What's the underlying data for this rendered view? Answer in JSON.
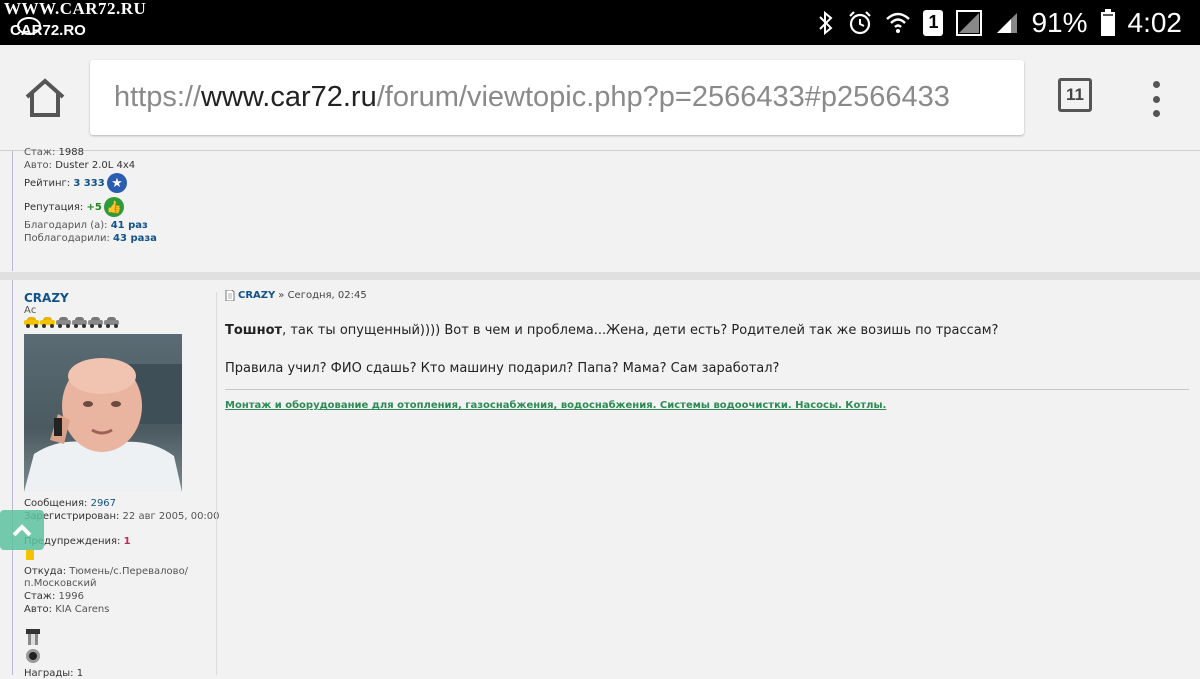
{
  "watermark": {
    "line1": "WWW.CAR72.RU",
    "line2": "CAR72.RO"
  },
  "statusbar": {
    "battery": "91%",
    "time": "4:02",
    "sim": "1",
    "icons": [
      "bluetooth-icon",
      "alarm-icon",
      "wifi-icon",
      "sim-icon",
      "no-signal-icon",
      "signal-icon",
      "battery-icon"
    ]
  },
  "toolbar": {
    "url_scheme": "https://",
    "url_domain": "www.car72.ru",
    "url_path": "/forum/viewtopic.php?p=2566433#p2566433",
    "tab_count": "11"
  },
  "prev_post": {
    "stazh_label": "Стаж:",
    "stazh_value": "1988",
    "auto_label": "Авто:",
    "auto_value": "Duster 2.0L 4x4",
    "rating_label": "Рейтинг:",
    "rating_value": "3 333",
    "rep_label": "Репутация:",
    "rep_value": "+5",
    "thanked_label": "Благодарил (а):",
    "thanked_value": "41 раз",
    "got_thanks_label": "Поблагодарили:",
    "got_thanks_value": "43 раза"
  },
  "post": {
    "username": "CRAZY",
    "rank": "Ас",
    "cars_filled": 2,
    "cars_total": 6,
    "messages_label": "Сообщения:",
    "messages_value": "2967",
    "registered_label": "Зарегистрирован:",
    "registered_value": "22 авг 2005, 00:00",
    "warnings_label": "Предупреждения:",
    "warnings_value": "1",
    "from_label": "Откуда:",
    "from_value_line1": "Тюмень/с.Перевалово/",
    "from_value_line2": "п.Московский",
    "stazh_label": "Стаж:",
    "stazh_value": "1996",
    "auto_label": "Авто:",
    "auto_value": "KIA Carens",
    "awards_label": "Награды: 1",
    "head_author": "CRAZY",
    "head_rest": "» Сегодня, 02:45",
    "para1_bold": "Тошнот",
    "para1_rest": ", так ты опущенный)))) Вот в чем и проблема...Жена, дети есть? Родителей так же возишь по трассам?",
    "para2": "Правила учил? ФИО сдашь? Кто машину подарил? Папа? Мама? Сам заработал?",
    "ad_link": "Монтаж и оборудование для отопления, газоснабжения, водоснабжения. Системы водоочистки. Насосы. Котлы."
  }
}
